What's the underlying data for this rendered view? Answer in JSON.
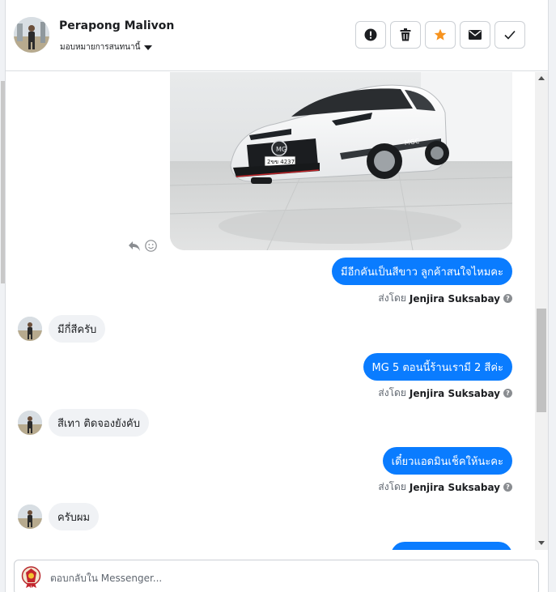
{
  "contact": {
    "name": "Perapong Malivon",
    "assign_label": "มอบหมายการสนทนานี้"
  },
  "toolbar": {
    "icons": [
      "exclamation-circle-icon",
      "trash-icon",
      "star-icon",
      "envelope-icon",
      "check-icon"
    ],
    "star_color": "#f7931e"
  },
  "messages": [
    {
      "type": "image",
      "direction": "out",
      "icons": [
        "reply-icon",
        "smiley-icon"
      ],
      "plate_text": "2ขข 4237"
    },
    {
      "type": "text",
      "direction": "out",
      "text": "มีอีกคันเป็นสีขาว ลูกค้าสนใจไหมคะ",
      "sent_by_label": "ส่งโดย",
      "sender": "Jenjira Suksabay"
    },
    {
      "type": "text",
      "direction": "in",
      "text": "มีกี่สีครับ"
    },
    {
      "type": "text",
      "direction": "out",
      "text": "MG 5 ตอนนี้ร้านเรามี 2 สีค่ะ",
      "sent_by_label": "ส่งโดย",
      "sender": "Jenjira Suksabay"
    },
    {
      "type": "text",
      "direction": "in",
      "text": "สีเทา ติดจองยังคับ"
    },
    {
      "type": "text",
      "direction": "out",
      "text": "เดี๋ยวแอดมินเช็คให้นะคะ",
      "sent_by_label": "ส่งโดย",
      "sender": "Jenjira Suksabay"
    },
    {
      "type": "text",
      "direction": "in",
      "text": "ครับผม"
    }
  ],
  "composer": {
    "placeholder": "ตอบกลับใน Messenger..."
  },
  "colors": {
    "accent": "#0a7cff",
    "incoming_bubble": "#f0f2f5"
  }
}
